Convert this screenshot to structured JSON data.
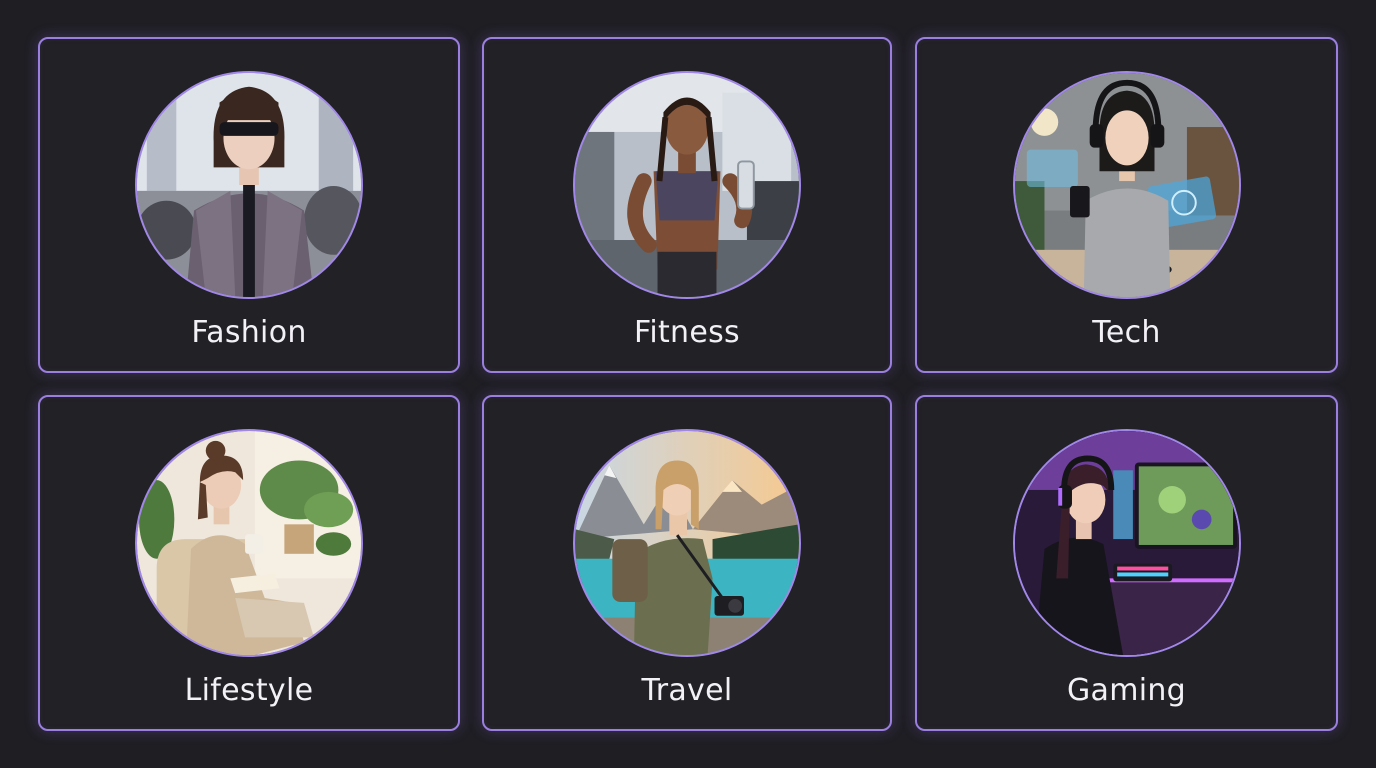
{
  "categories": [
    {
      "label": "Fashion",
      "icon": "fashion-avatar"
    },
    {
      "label": "Fitness",
      "icon": "fitness-avatar"
    },
    {
      "label": "Tech",
      "icon": "tech-avatar"
    },
    {
      "label": "Lifestyle",
      "icon": "lifestyle-avatar"
    },
    {
      "label": "Travel",
      "icon": "travel-avatar"
    },
    {
      "label": "Gaming",
      "icon": "gaming-avatar"
    }
  ],
  "colors": {
    "background": "#1f1e23",
    "card": "#222126",
    "accent_border": "#9a7fe0",
    "label_text": "#f2f1f6"
  }
}
